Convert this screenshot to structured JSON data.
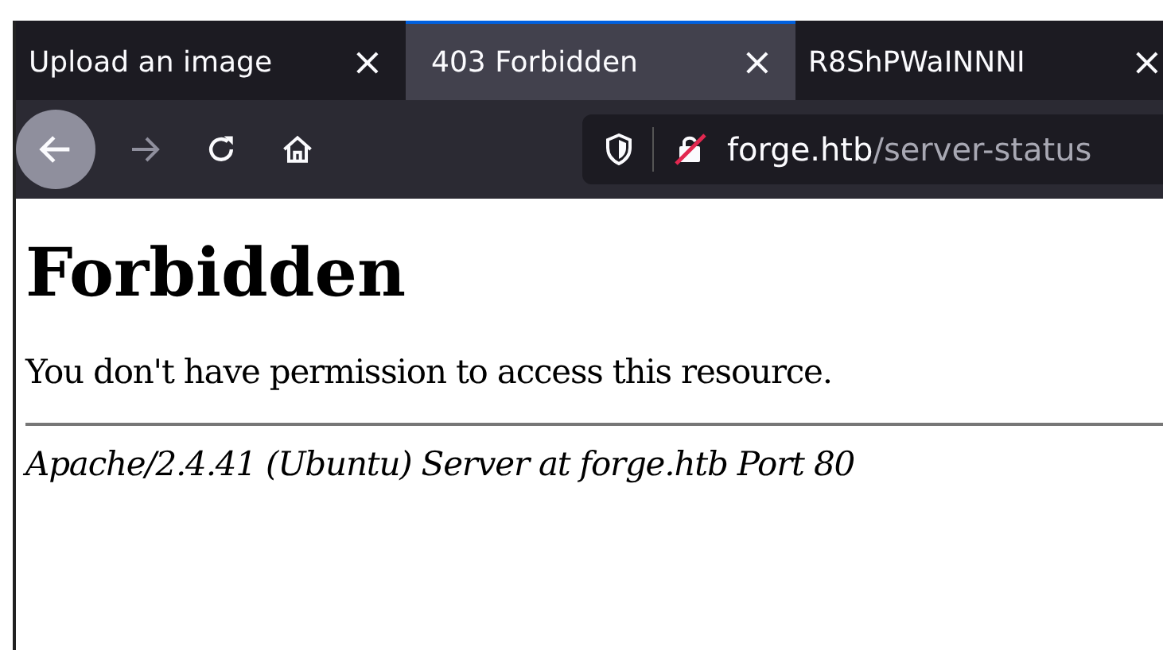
{
  "tabs": [
    {
      "label": "Upload an image",
      "close": "×",
      "selected": false
    },
    {
      "label": "403 Forbidden",
      "close": "×",
      "selected": true
    },
    {
      "label": "R8ShPWaINNNI",
      "close": "×",
      "selected": false
    }
  ],
  "toolbar": {
    "back_disabled": false,
    "forward_disabled": true
  },
  "address_bar": {
    "host": "forge.htb",
    "path": "/server-status"
  },
  "page": {
    "heading": "Forbidden",
    "message": "You don't have permission to access this resource.",
    "address": "Apache/2.4.41 (Ubuntu) Server at forge.htb Port 80"
  }
}
